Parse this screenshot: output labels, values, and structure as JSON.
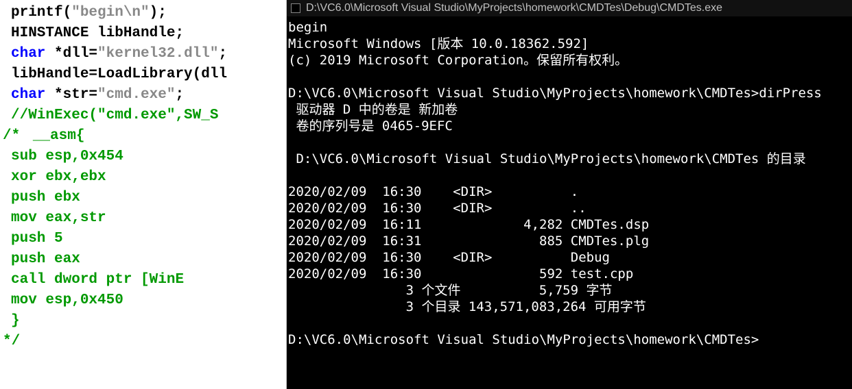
{
  "code": {
    "lines": [
      {
        "parts": [
          {
            "text": "    printf(",
            "cls": ""
          },
          {
            "text": "\"begin\\n\"",
            "cls": "str-gray"
          },
          {
            "text": ");",
            "cls": ""
          }
        ]
      },
      {
        "parts": [
          {
            "text": "    HINSTANCE libHandle;",
            "cls": ""
          }
        ]
      },
      {
        "parts": [
          {
            "text": "    ",
            "cls": ""
          },
          {
            "text": "char",
            "cls": "kw-blue"
          },
          {
            "text": " *dll=",
            "cls": ""
          },
          {
            "text": "\"kernel32.dll\"",
            "cls": "str-gray"
          },
          {
            "text": ";",
            "cls": ""
          }
        ]
      },
      {
        "parts": [
          {
            "text": "    libHandle=LoadLibrary(dll",
            "cls": ""
          }
        ]
      },
      {
        "parts": [
          {
            "text": "    ",
            "cls": ""
          },
          {
            "text": "char",
            "cls": "kw-blue"
          },
          {
            "text": " *str=",
            "cls": ""
          },
          {
            "text": "\"cmd.exe\"",
            "cls": "str-gray"
          },
          {
            "text": ";",
            "cls": ""
          }
        ]
      },
      {
        "parts": [
          {
            "text": "    //WinExec(\"cmd.exe\",SW_S",
            "cls": "comment"
          }
        ]
      },
      {
        "parts": [
          {
            "text": " ",
            "cls": ""
          }
        ]
      },
      {
        "gutter": "/*",
        "parts": [
          {
            "text": "    __asm{",
            "cls": "comment"
          }
        ]
      },
      {
        "parts": [
          {
            "text": "        sub esp,0x454",
            "cls": "comment"
          }
        ]
      },
      {
        "parts": [
          {
            "text": "        xor ebx,ebx",
            "cls": "comment"
          }
        ]
      },
      {
        "parts": [
          {
            "text": "        push ebx",
            "cls": "comment"
          }
        ]
      },
      {
        "parts": [
          {
            "text": "        mov eax,str",
            "cls": "comment"
          }
        ]
      },
      {
        "parts": [
          {
            "text": "        push 5",
            "cls": "comment"
          }
        ]
      },
      {
        "parts": [
          {
            "text": "        push eax",
            "cls": "comment"
          }
        ]
      },
      {
        "parts": [
          {
            "text": "        call dword ptr [WinE",
            "cls": "comment"
          }
        ]
      },
      {
        "parts": [
          {
            "text": "        mov esp,0x450",
            "cls": "comment"
          }
        ]
      },
      {
        "parts": [
          {
            "text": "    }",
            "cls": "comment"
          }
        ]
      },
      {
        "gutter": "*/",
        "parts": []
      }
    ]
  },
  "console": {
    "title": "D:\\VC6.0\\Microsoft Visual Studio\\MyProjects\\homework\\CMDTes\\Debug\\CMDTes.exe",
    "lines": [
      "begin",
      "Microsoft Windows [版本 10.0.18362.592]",
      "(c) 2019 Microsoft Corporation。保留所有权利。",
      "",
      "D:\\VC6.0\\Microsoft Visual Studio\\MyProjects\\homework\\CMDTes>dirPress",
      " 驱动器 D 中的卷是 新加卷",
      " 卷的序列号是 0465-9EFC",
      "",
      " D:\\VC6.0\\Microsoft Visual Studio\\MyProjects\\homework\\CMDTes 的目录",
      "",
      "2020/02/09  16:30    <DIR>          .",
      "2020/02/09  16:30    <DIR>          ..",
      "2020/02/09  16:11             4,282 CMDTes.dsp",
      "2020/02/09  16:31               885 CMDTes.plg",
      "2020/02/09  16:30    <DIR>          Debug",
      "2020/02/09  16:30               592 test.cpp",
      "               3 个文件          5,759 字节",
      "               3 个目录 143,571,083,264 可用字节",
      "",
      "D:\\VC6.0\\Microsoft Visual Studio\\MyProjects\\homework\\CMDTes>"
    ]
  }
}
